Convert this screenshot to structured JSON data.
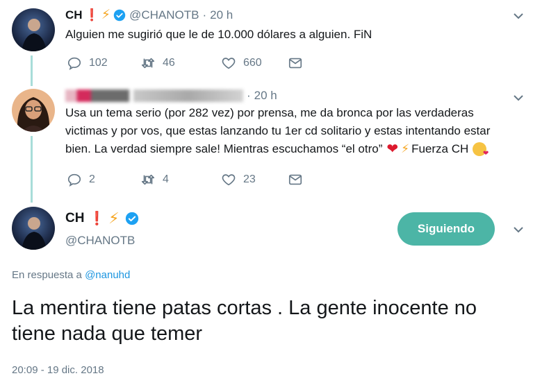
{
  "tweet1": {
    "name": "CH",
    "handle": "@CHANOTB",
    "separator": "·",
    "time": "20 h",
    "text": "Alguien me sugirió que le de 10.000 dólares a alguien. FiN",
    "replies": "102",
    "retweets": "46",
    "likes": "660"
  },
  "tweet2": {
    "name": "Usuario",
    "handle": "@usuario",
    "separator": "·",
    "time": "20 h",
    "text_parts": [
      "Usa un tema serio (por 282 vez) por prensa, me da bronca por las verdaderas",
      "victimas y por vos, que estas lanzando tu 1er cd solitario y estas intentando estar",
      "bien. La verdad siempre sale! Mientras escuchamos “el otro”",
      "Fuerza CH"
    ],
    "replies": "2",
    "retweets": "4",
    "likes": "23"
  },
  "main_tweet": {
    "name": "CH",
    "handle": "@CHANOTB",
    "follow_label": "Siguiendo",
    "reply_prefix": "En respuesta a",
    "reply_handle": "@nanuhd",
    "text": "La mentira tiene patas cortas . La gente inocente no tiene nada que temer",
    "timestamp": "20:09 - 19 dic. 2018"
  },
  "icons": {
    "reply": "reply-icon",
    "retweet": "retweet-icon",
    "like": "heart-icon",
    "dm": "envelope-icon",
    "verified": "verified-badge-icon",
    "more": "chevron-down-icon"
  },
  "colors": {
    "thread_line": "#a8ddd9",
    "follow_button": "#4cb5a6",
    "link": "#1b95e0",
    "muted": "#657786",
    "verified": "#1da1f2"
  }
}
